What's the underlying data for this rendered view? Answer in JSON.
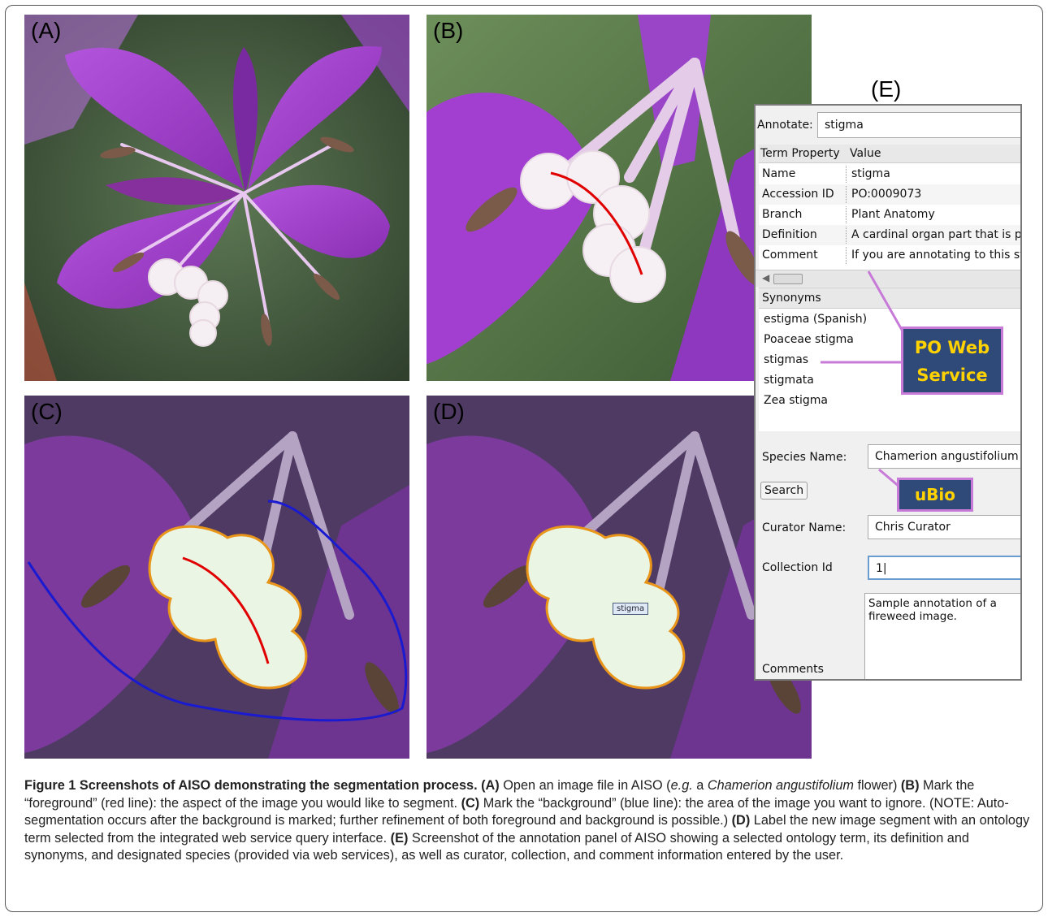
{
  "panels": {
    "a_label": "(A)",
    "b_label": "(B)",
    "c_label": "(C)",
    "d_label": "(D)",
    "e_label": "(E)",
    "segment_tag": "stigma"
  },
  "annotation": {
    "annotate_label": "Annotate:",
    "annotate_value": "stigma",
    "table_header": {
      "property": "Term Property",
      "value": "Value"
    },
    "rows": [
      {
        "property": "Name",
        "value": "stigma"
      },
      {
        "property": "Accession ID",
        "value": "PO:0009073"
      },
      {
        "property": "Branch",
        "value": "Plant Anatomy"
      },
      {
        "property": "Definition",
        "value": "A cardinal organ part that is p"
      },
      {
        "property": "Comment",
        "value": "If you are annotating to this st"
      }
    ],
    "synonyms_header": "Synonyms",
    "synonyms": [
      "estigma (Spanish)",
      "Poaceae stigma",
      "stigmas",
      "stigmata",
      "Zea stigma"
    ],
    "species_label": "Species Name:",
    "species_value": "Chamerion angustifolium",
    "search_button": "Search",
    "curator_label": "Curator Name:",
    "curator_value": "Chris Curator",
    "collection_label": "Collection Id",
    "collection_value": "1|",
    "comments_label": "Comments",
    "comments_value": "Sample annotation of a fireweed image."
  },
  "callouts": {
    "po_line1": "PO Web",
    "po_line2": "Service",
    "ubio": "uBio"
  },
  "caption": {
    "title": "Figure 1 Screenshots of AISO demonstrating the segmentation process.",
    "a_tag": "(A)",
    "a_text1": " Open an image file in AISO (",
    "a_eg": "e.g.",
    "a_text2": " a ",
    "a_species": "Chamerion angustifolium",
    "a_text3": " flower) ",
    "b_tag": "(B)",
    "b_text": " Mark the “foreground” (red line): the aspect of the image you would like to segment. ",
    "c_tag": "(C)",
    "c_text": " Mark the “background” (blue line): the area of the image you want to ignore. (NOTE: Auto-segmentation occurs after the background is marked; further refinement of both foreground and background is possible.) ",
    "d_tag": "(D)",
    "d_text": " Label the new image segment with an ontology term selected from the integrated web service query interface. ",
    "e_tag": "(E)",
    "e_text": " Screenshot of the annotation panel of AISO showing a selected ontology term, its definition and synonyms, and designated species (provided via web services), as well as curator, collection, and comment information entered by the user."
  },
  "colors": {
    "petal": "#a63fd0",
    "stigma": "#f4eef2",
    "foreground_line": "#e00000",
    "background_line": "#1a1ad0",
    "segment_fill": "#eaf5e4",
    "segment_outline": "#e8951a",
    "callout_bg": "#2f4a78",
    "callout_border": "#c77ad8",
    "callout_text": "#ffd200"
  }
}
